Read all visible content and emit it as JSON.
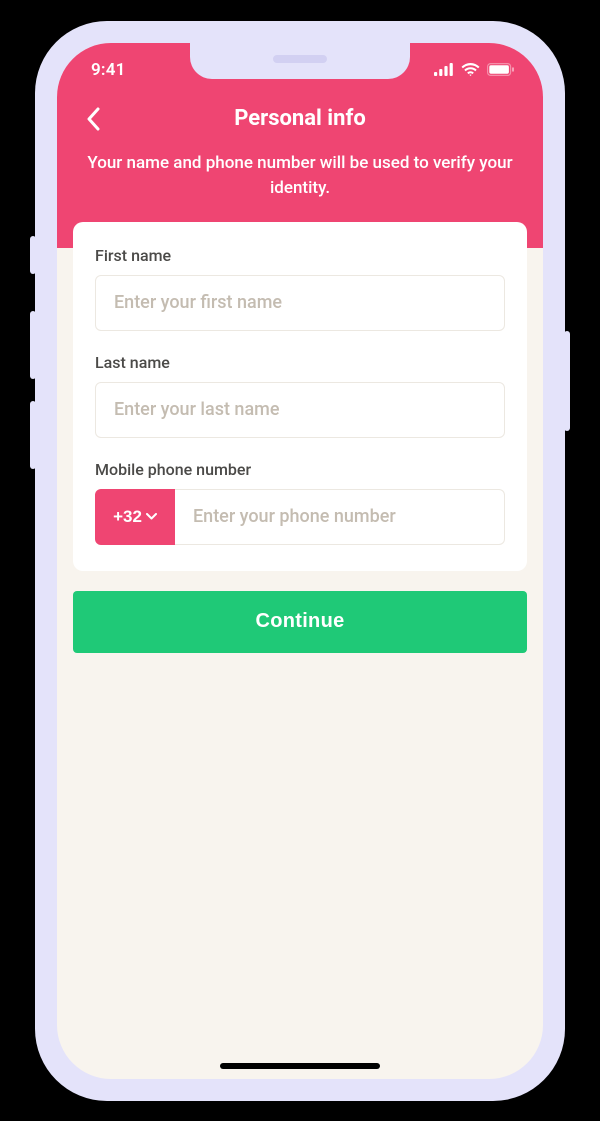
{
  "status": {
    "time": "9:41"
  },
  "header": {
    "title": "Personal info",
    "subtitle": "Your name and phone number will be used to verify your identity."
  },
  "form": {
    "first_name": {
      "label": "First name",
      "placeholder": "Enter your first name",
      "value": ""
    },
    "last_name": {
      "label": "Last name",
      "placeholder": "Enter your last name",
      "value": ""
    },
    "phone": {
      "label": "Mobile phone number",
      "country_code": "+32",
      "placeholder": "Enter your phone number",
      "value": ""
    }
  },
  "actions": {
    "continue": "Continue"
  },
  "colors": {
    "accent_pink": "#ef4572",
    "accent_green": "#1FC977",
    "bg_cream": "#f8f4ee"
  }
}
